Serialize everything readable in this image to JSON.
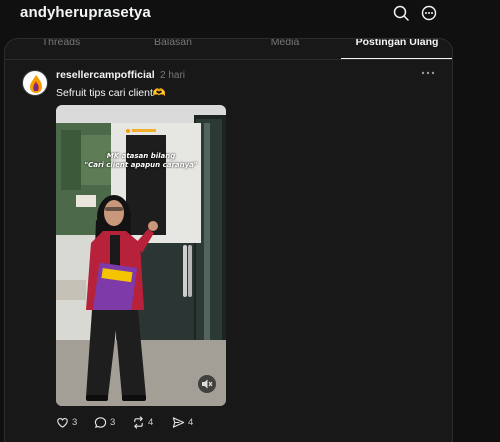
{
  "profile": {
    "username": "andyheruprasetya",
    "icons": {
      "right_1": "instagram-icon",
      "right_2": "more-circle-icon"
    }
  },
  "tabs": [
    {
      "label": "Threads",
      "active": false
    },
    {
      "label": "Balasan",
      "active": false
    },
    {
      "label": "Media",
      "active": false
    },
    {
      "label": "Postingan Ulang",
      "active": true
    }
  ],
  "post": {
    "author": "resellercampofficial",
    "time": "2 hari",
    "text": "Sefruit tips cari client🫶",
    "video": {
      "overlay_line1": "MK atasan bilang",
      "overlay_line2": "\"Cari client apapun caranya\"",
      "mute_icon": "speaker-muted-icon"
    },
    "actions": {
      "like_count": "3",
      "reply_count": "3",
      "repost_count": "4",
      "share_count": "4"
    }
  },
  "colors": {
    "background": "#101010",
    "card": "#181818",
    "border": "#2d2d2d",
    "text": "#f3f5f7",
    "muted": "#777777",
    "brand_orange": "#f5a000"
  }
}
